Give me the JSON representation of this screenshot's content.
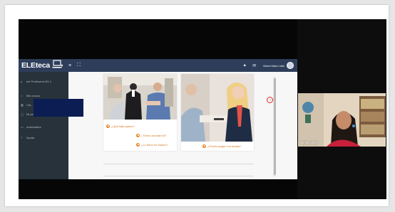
{
  "app": {
    "logo_text": "ELEteca",
    "header_icons": [
      "menu-icon",
      "fullscreen-icon",
      "bell-icon",
      "mail-icon"
    ],
    "user_name": "María Mato Lallo"
  },
  "sidebar": {
    "items": [
      {
        "icon": "graduation-icon",
        "label": "ele Profesores B1.1"
      },
      {
        "icon": "home-icon",
        "label": "Mis cursos"
      },
      {
        "icon": "calendar-icon",
        "label": "Cal..."
      },
      {
        "icon": "message-icon",
        "label": "Mi perfil"
      },
      {
        "icon": "book-icon",
        "label": "Actividades"
      },
      {
        "icon": "support-icon",
        "label": "Ayuda"
      }
    ]
  },
  "exercise": {
    "questions_left": [
      "¿Qué talla quiere?",
      "¿Tiene una talla M?",
      "¿Lo tiene en blanco?"
    ],
    "questions_right": [
      "¿Puedo pagar con tarjeta?"
    ],
    "next_icon": "next-arrow-icon"
  },
  "webcam": {
    "name_label": "Nellie Chilly"
  },
  "colors": {
    "header": "#2e3e5a",
    "sidebar": "#27323b",
    "accent_orange": "#e67e1e",
    "next_red": "#d9281f",
    "redaction": "#0b1d53"
  }
}
